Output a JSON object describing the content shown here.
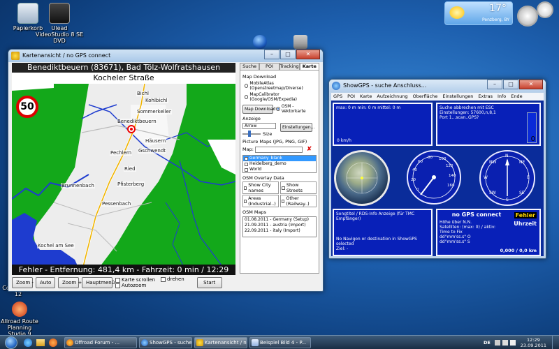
{
  "desktop": {
    "icons": [
      {
        "label": "Papierkorb"
      },
      {
        "label": "Ulead VideoStudio 8 SE DVD"
      },
      {
        "label": "Companion 12"
      },
      {
        "label": "Allroad Route Planning Studio 9"
      }
    ],
    "weather": {
      "temp": "17°",
      "location": "Penzberg, BY"
    }
  },
  "map_window": {
    "title": "Kartenansicht / no GPS connect",
    "region_header": "Benediktbeuern (83671), Bad Tölz-Wolfratshausen",
    "street": "Kocheler Straße",
    "speed_limit": "50",
    "status_footer": "Fehler - Entfernung: 481,4 km - Fahrzeit: 0 min / 12:29",
    "map_labels": [
      "Bichl",
      "Benediktbeuern",
      "Häusern",
      "Pechlern",
      "Gschwendt",
      "Ried",
      "Pfisterberg",
      "Brunnenbach",
      "Pessenbach",
      "Kochel am See",
      "Sommerkeller",
      "Kohlbichl"
    ],
    "buttons": {
      "zoom_out": "Zoom -",
      "auto": "Auto",
      "zoom_in": "Zoom +",
      "main_menu": "Hauptmenü",
      "start": "Start"
    },
    "checkboxes": {
      "scroll_map": "Karte scrollen",
      "rotate": "drehen",
      "autozoom": "Autozoom"
    },
    "tabs": [
      "Suche",
      "POI",
      "Tracking",
      "Karte"
    ],
    "panel": {
      "map_download_label": "Map Download",
      "radio_mobileatlas": "MobileAtlas (Openstreetmap/Diverse)",
      "radio_mapcalibrator": "MapCalibrator (Google/OSM/Expedia)",
      "map_download_button": "Map Download",
      "radio_osm": "OSM - Vektorkarte",
      "anzeige_label": "Anzeige",
      "arrow_select": "Arrow",
      "settings_button": "Einstellungen...",
      "size_label": "Size",
      "picture_maps_label": "Picture Maps (JPG, PNG, GIF)",
      "map_field_label": "Map:",
      "map_list": [
        "Germany_blank",
        "Heidelberg_demo",
        "World"
      ],
      "osm_overlay_label": "OSM Overlay Data",
      "overlay_show_city": "Show City names",
      "overlay_show_streets": "Show Streets",
      "overlay_areas": "Areas (Industrial..)",
      "overlay_other": "Other (Railway..)",
      "osm_maps_label": "OSM Maps",
      "osm_maps": [
        "01.08.2011 - Germany (Setup)",
        "21.09.2011 - austria (Import)",
        "22.09.2011 - italy (Import)"
      ]
    }
  },
  "gps_window": {
    "title": "ShowGPS - suche Anschluss...",
    "menu": [
      "GPS",
      "POI",
      "Karte",
      "Aufzeichnung",
      "Oberfläche",
      "Einstellungen",
      "Extras",
      "Info",
      "Ende"
    ],
    "speed_box": {
      "line": "max: 0 m min: 0 m mittel: 0 m",
      "unit": "0 km/h"
    },
    "info_box": {
      "line1": "Suche abbrechen mit ESC",
      "line2": "Einstellungen: 57600,n,8,1",
      "line3": "Port 1...scan..GPS?",
      "value": "0"
    },
    "speedometer_ticks": [
      "0",
      "20",
      "40",
      "60",
      "80",
      "100",
      "120",
      "140",
      "160"
    ],
    "compass": [
      "N",
      "NE",
      "E",
      "SE",
      "S",
      "SW",
      "W",
      "NW"
    ],
    "songtitle_box": {
      "title": "Songtitel / RDS-Info Anzeige (für TMC Empfänger)",
      "line1": "No Navigon or destination in ShowGPS selected",
      "line2": "Ziel: -"
    },
    "status_box": {
      "title": "no GPS connect",
      "error": "Fehler",
      "time_label": "Uhrzeit",
      "height": "Höhe über N.N.",
      "satellites": "Satelliten: (max: 0) / aktiv:",
      "time_to_fix": "Time to Fix",
      "lat": "dd°mm'ss.s\" O",
      "lon": "dd°mm'ss.s\" S",
      "distance": "0,000 / 0,0 km"
    }
  },
  "taskbar": {
    "items": [
      "Offroad Forum - ...",
      "ShowGPS - suche ...",
      "Kartenansicht / n...",
      "Beispiel Bild 4 - P..."
    ],
    "language": "DE",
    "time": "12:29",
    "date": "23.09.2011"
  }
}
